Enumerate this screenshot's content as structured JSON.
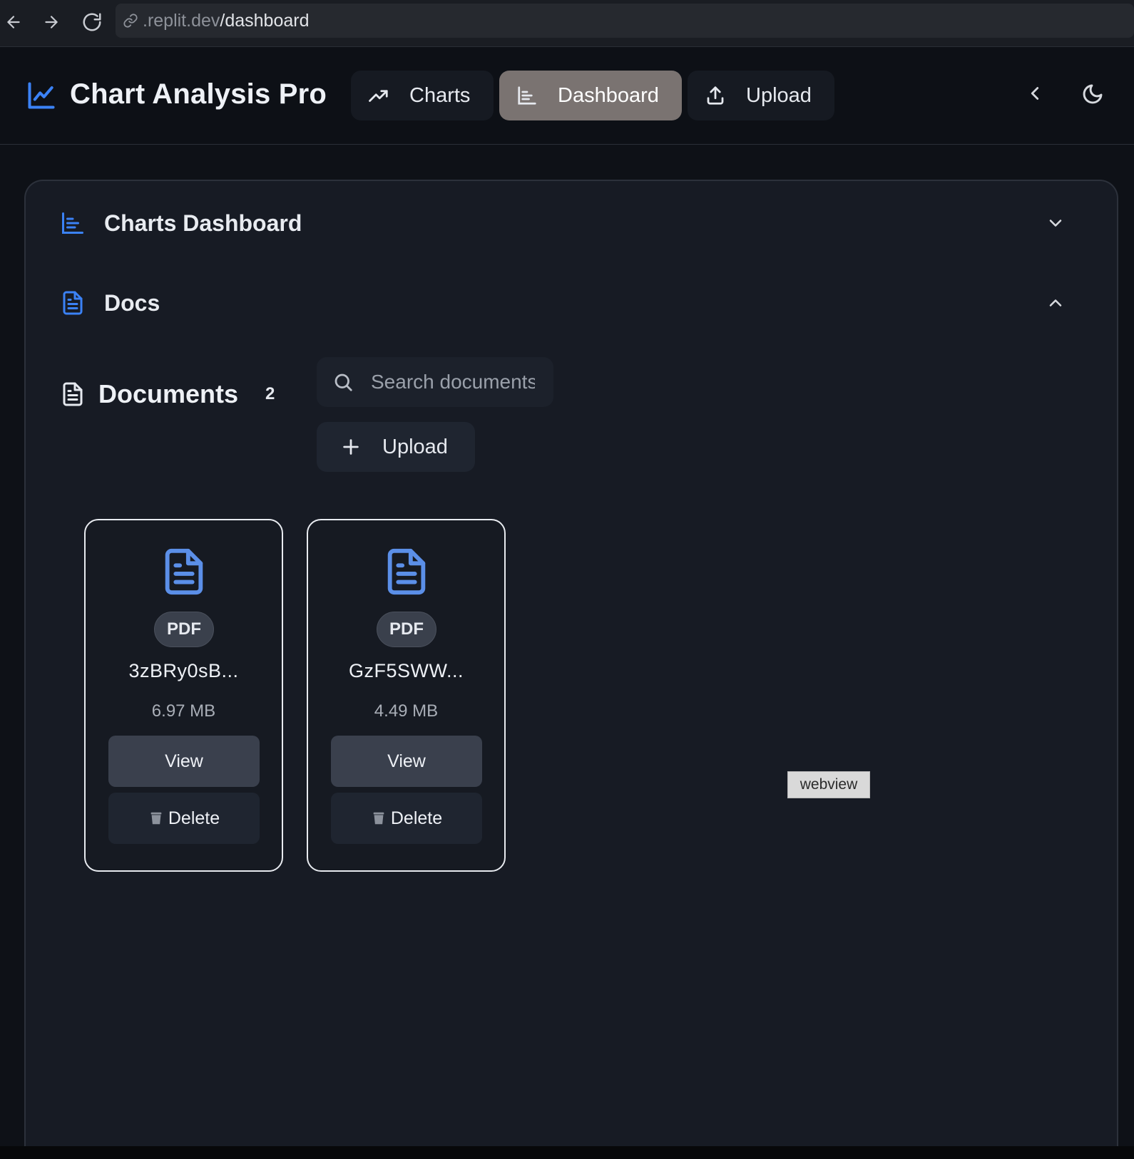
{
  "browser": {
    "url_host": ".replit.dev",
    "url_path": "/dashboard"
  },
  "header": {
    "title": "Chart Analysis Pro",
    "nav": [
      {
        "label": "Charts",
        "icon": "trending-up-icon"
      },
      {
        "label": "Dashboard",
        "icon": "bar-chart-icon",
        "active": true
      },
      {
        "label": "Upload",
        "icon": "upload-icon"
      }
    ]
  },
  "sections": {
    "charts_dashboard": "Charts Dashboard",
    "docs": "Docs"
  },
  "documents": {
    "title": "Documents",
    "count": "2",
    "search_placeholder": "Search documents...",
    "upload_label": "Upload",
    "items": [
      {
        "type": "PDF",
        "name": "3zBRy0sB...",
        "size": "6.97 MB",
        "view": "View",
        "delete": "Delete"
      },
      {
        "type": "PDF",
        "name": "GzF5SWW...",
        "size": "4.49 MB",
        "view": "View",
        "delete": "Delete"
      }
    ]
  },
  "overlay": {
    "tag": "webview"
  },
  "colors": {
    "accent": "#3b82f6",
    "active_nav": "#7a7371",
    "background": "#0e1117",
    "panel": "#171b24"
  }
}
